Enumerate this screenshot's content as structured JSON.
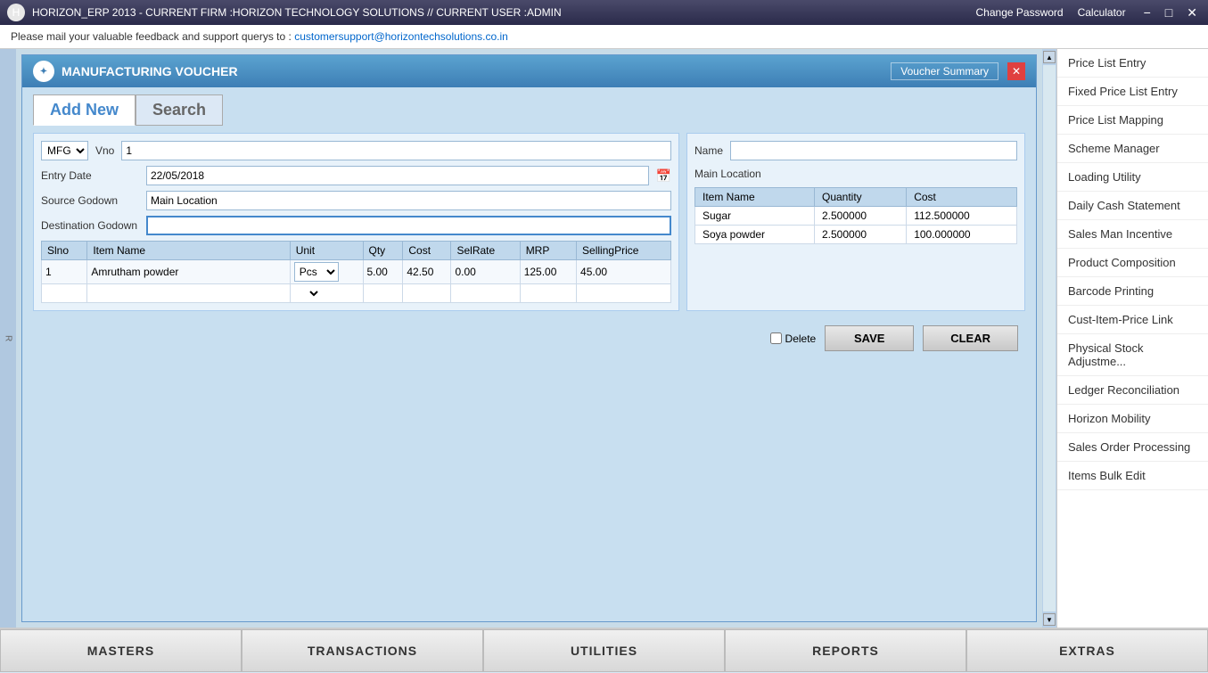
{
  "titlebar": {
    "title": "HORIZON_ERP 2013 - CURRENT FIRM :HORIZON TECHNOLOGY SOLUTIONS // CURRENT USER :ADMIN",
    "change_password": "Change Password",
    "calculator": "Calculator",
    "minimize": "−",
    "maximize": "□",
    "close": "✕"
  },
  "feedback": {
    "message": "Please mail your valuable feedback and support querys to :",
    "email": "customersupport@horizontechsolutions.co.in"
  },
  "voucher": {
    "title": "MANUFACTURING VOUCHER",
    "voucher_summary": "Voucher Summary",
    "close": "✕"
  },
  "tabs": {
    "add_new": "Add New",
    "search": "Search"
  },
  "form": {
    "type_value": "MFG",
    "vno_label": "Vno",
    "vno_value": "1",
    "entry_date_label": "Entry Date",
    "entry_date_value": "22/05/2018",
    "source_godown_label": "Source Godown",
    "source_godown_value": "Main Location",
    "destination_godown_label": "Destination Godown",
    "destination_godown_value": "",
    "name_label": "Name",
    "name_value": "",
    "main_location": "Main Location"
  },
  "items_table": {
    "headers": [
      "Slno",
      "Item Name",
      "Unit",
      "Qty",
      "Cost",
      "SelRate",
      "MRP",
      "SellingPrice"
    ],
    "rows": [
      {
        "slno": "1",
        "item": "Amrutham powder",
        "unit": "Pcs",
        "qty": "5.00",
        "cost": "42.50",
        "selrate": "0.00",
        "mrp": "125.00",
        "selling": "45.00"
      }
    ]
  },
  "right_table": {
    "headers": [
      "Item Name",
      "Quantity",
      "Cost"
    ],
    "rows": [
      {
        "item": "Sugar",
        "quantity": "2.500000",
        "cost": "112.500000"
      },
      {
        "item": "Soya powder",
        "quantity": "2.500000",
        "cost": "100.000000"
      }
    ]
  },
  "buttons": {
    "delete_label": "Delete",
    "save_label": "SAVE",
    "clear_label": "CLEAR"
  },
  "sidebar": {
    "items": [
      "Price List Entry",
      "Fixed Price List Entry",
      "Price List Mapping",
      "Scheme Manager",
      "Loading Utility",
      "Daily Cash Statement",
      "Sales Man Incentive",
      "Product Composition",
      "Barcode Printing",
      "Cust-Item-Price Link",
      "Physical Stock Adjustme...",
      "Ledger Reconciliation",
      "Horizon Mobility",
      "Sales Order Processing",
      "Items Bulk Edit"
    ]
  },
  "bottom_nav": {
    "masters": "MASTERS",
    "transactions": "TRANSACTIONS",
    "utilities": "UTILITIES",
    "reports": "REPORTS",
    "extras": "EXTRAS"
  }
}
